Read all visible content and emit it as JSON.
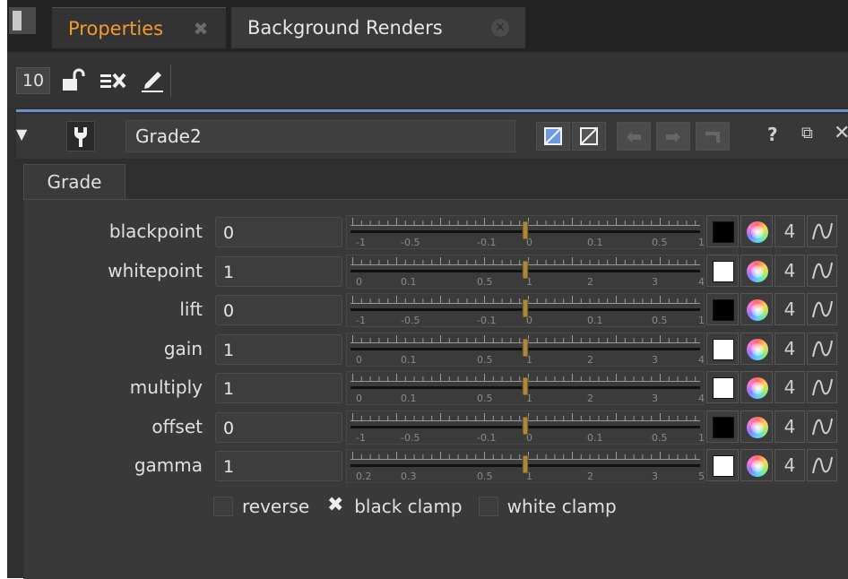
{
  "tabs": [
    {
      "label": "Properties",
      "active": true
    },
    {
      "label": "Background Renders",
      "active": false
    }
  ],
  "toolbar": {
    "max_panels": "10"
  },
  "node": {
    "name": "Grade2",
    "tab": "Grade"
  },
  "knobs": [
    {
      "label": "blackpoint",
      "value": "0",
      "swatch": "#000000",
      "channels": "4",
      "slider_ticks": [
        "-1",
        "-0.5",
        "-0.1",
        "0",
        "0.1",
        "0.5",
        "1"
      ]
    },
    {
      "label": "whitepoint",
      "value": "1",
      "swatch": "#ffffff",
      "channels": "4",
      "slider_ticks": [
        "0",
        "0.1",
        "0.5",
        "1",
        "2",
        "3",
        "4"
      ]
    },
    {
      "label": "lift",
      "value": "0",
      "swatch": "#000000",
      "channels": "4",
      "slider_ticks": [
        "-1",
        "-0.5",
        "-0.1",
        "0",
        "0.1",
        "0.5",
        "1"
      ]
    },
    {
      "label": "gain",
      "value": "1",
      "swatch": "#ffffff",
      "channels": "4",
      "slider_ticks": [
        "0",
        "0.1",
        "0.5",
        "1",
        "2",
        "3",
        "4"
      ]
    },
    {
      "label": "multiply",
      "value": "1",
      "swatch": "#ffffff",
      "channels": "4",
      "slider_ticks": [
        "0",
        "0.1",
        "0.5",
        "1",
        "2",
        "3",
        "4"
      ]
    },
    {
      "label": "offset",
      "value": "0",
      "swatch": "#000000",
      "channels": "4",
      "slider_ticks": [
        "-1",
        "-0.5",
        "-0.1",
        "0",
        "0.1",
        "0.5",
        "1"
      ]
    },
    {
      "label": "gamma",
      "value": "1",
      "swatch": "#ffffff",
      "channels": "4",
      "slider_ticks": [
        "0.2",
        "0.3",
        "0.5",
        "1",
        "2",
        "3",
        "5"
      ]
    }
  ],
  "checkboxes": [
    {
      "label": "reverse",
      "checked": false
    },
    {
      "label": "black clamp",
      "checked": true
    },
    {
      "label": "white clamp",
      "checked": false
    }
  ],
  "icons": {
    "check_mark": "✖",
    "help": "?",
    "float": "⧉",
    "close": "✕",
    "collapse": "▼"
  },
  "colors": {
    "active_tab": "#f29a2e",
    "separator": "#6d8fcf"
  }
}
